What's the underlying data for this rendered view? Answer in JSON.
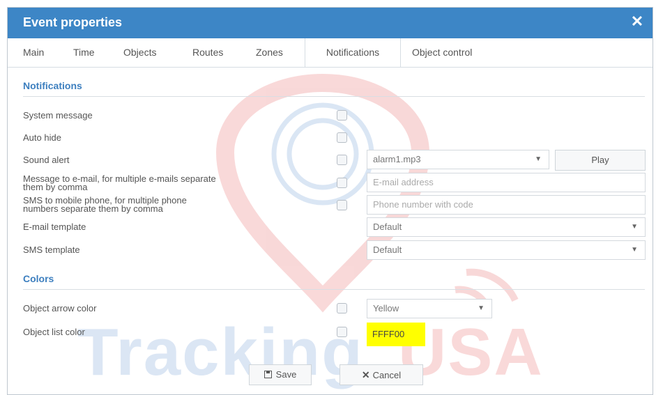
{
  "dialog": {
    "title": "Event properties",
    "close_glyph": "✕"
  },
  "tabs": [
    {
      "label": "Main",
      "active": false
    },
    {
      "label": "Time",
      "active": false
    },
    {
      "label": "Objects",
      "active": false
    },
    {
      "label": "Routes",
      "active": false
    },
    {
      "label": "Zones",
      "active": false
    },
    {
      "label": "Notifications",
      "active": true
    },
    {
      "label": "Object control",
      "active": false
    }
  ],
  "notifications": {
    "heading": "Notifications",
    "system_message": "System message",
    "auto_hide": "Auto hide",
    "sound_alert": "Sound alert",
    "sound_file": "alarm1.mp3",
    "play": "Play",
    "email_label_1": "Message to e-mail, for multiple e-mails separate",
    "email_label_2": "them by comma",
    "email_placeholder": "E-mail address",
    "sms_label_1": "SMS to mobile phone, for multiple phone",
    "sms_label_2": "numbers separate them by comma",
    "phone_placeholder": "Phone number with code",
    "email_template_label": "E-mail template",
    "email_template_value": "Default",
    "sms_template_label": "SMS template",
    "sms_template_value": "Default"
  },
  "colors": {
    "heading": "Colors",
    "arrow_label": "Object arrow color",
    "arrow_value": "Yellow",
    "list_label": "Object list color",
    "list_value": "FFFF00",
    "list_swatch": "#ffff00"
  },
  "footer": {
    "save": "Save",
    "cancel": "Cancel"
  },
  "watermark": {
    "text_tracking": "Tracking",
    "text_usa": "USA"
  },
  "theme": {
    "accent": "#3d86c6",
    "heading_blue": "#3d7fbf"
  },
  "icons": {
    "close": "close-icon",
    "caret": "chevron-down-icon",
    "save": "floppy-disk-icon",
    "cancel": "x-icon"
  }
}
